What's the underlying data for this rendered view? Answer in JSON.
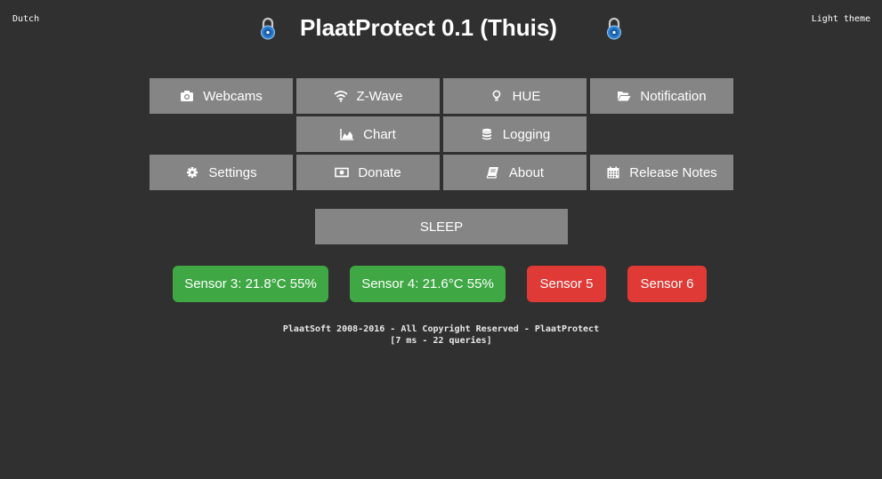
{
  "header": {
    "language_link": "Dutch",
    "theme_link": "Light theme",
    "title": "PlaatProtect 0.1 (Thuis)"
  },
  "menu": {
    "webcams": "Webcams",
    "zwave": "Z-Wave",
    "hue": "HUE",
    "notification": "Notification",
    "chart": "Chart",
    "logging": "Logging",
    "settings": "Settings",
    "donate": "Donate",
    "about": "About",
    "release_notes": "Release Notes"
  },
  "sleep_button": "SLEEP",
  "sensors": [
    {
      "label": "Sensor 3: 21.8°C 55%",
      "status_color": "#3fa845"
    },
    {
      "label": "Sensor 4: 21.6°C 55%",
      "status_color": "#3fa845"
    },
    {
      "label": "Sensor 5",
      "status_color": "#e03a36"
    },
    {
      "label": "Sensor 6",
      "status_color": "#e03a36"
    }
  ],
  "footer": {
    "copyright": "PlaatSoft 2008-2016 - All Copyright Reserved - PlaatProtect",
    "stats": "[7 ms - 22 queries]"
  },
  "colors": {
    "background": "#303030",
    "button": "#858585",
    "ok": "#3fa845",
    "alert": "#e03a36"
  }
}
